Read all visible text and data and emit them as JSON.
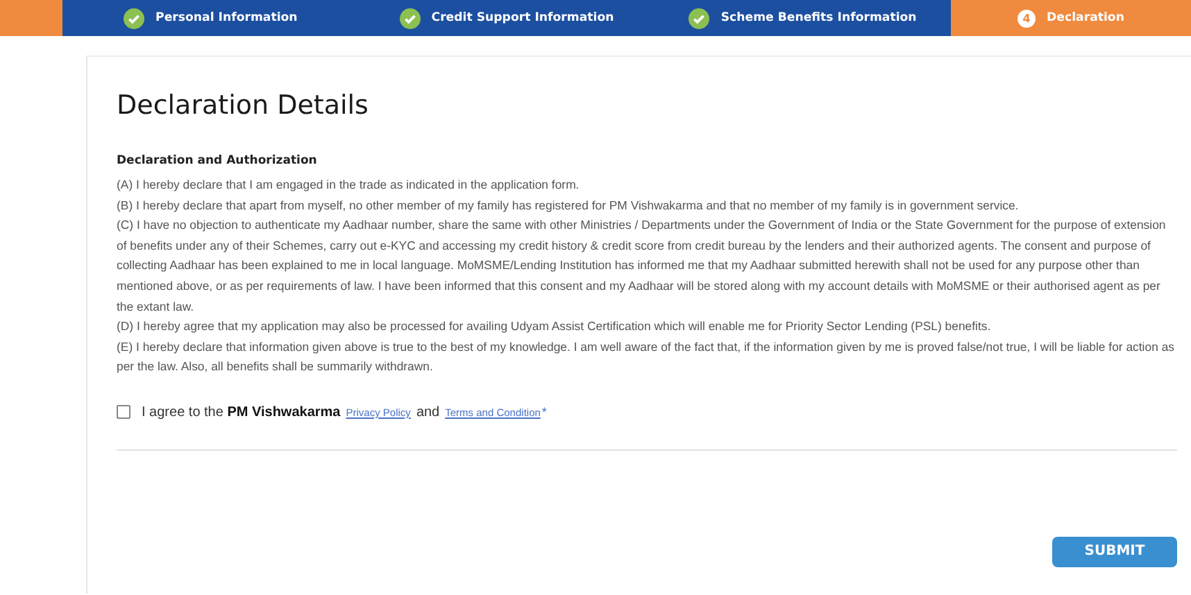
{
  "steps": [
    {
      "label": "Personal Information",
      "kind": "completed",
      "selected": false
    },
    {
      "label": "Credit Support Information",
      "kind": "completed",
      "selected": false
    },
    {
      "label": "Scheme Benefits Information",
      "kind": "completed",
      "selected": false
    },
    {
      "label": "Declaration",
      "kind": "current",
      "number": "4",
      "selected": true
    }
  ],
  "page_title": "Declaration Details",
  "section_title": "Declaration and Authorization",
  "declarations": [
    "(A) I hereby declare that I am engaged in the trade as indicated in the application form.",
    "(B) I hereby declare that apart from myself, no other member of my family has registered for PM Vishwakarma and that no member of my family is in government service.",
    "(C) I have no objection to authenticate my Aadhaar number, share the same with other Ministries / Departments under the Government of India or the State Government for the purpose of extension of benefits under any of their Schemes, carry out e-KYC and accessing my credit history & credit score from credit bureau by the lenders and their authorized agents. The consent and purpose of collecting Aadhaar has been explained to me in local language. MoMSME/Lending Institution has informed me that my Aadhaar submitted herewith shall not be used for any purpose other than mentioned above, or as per requirements of law. I have been informed that this consent and my Aadhaar will be stored along with my account details with MoMSME or their authorised agent as per the extant law.",
    "(D) I hereby agree that my application may also be processed for availing Udyam Assist Certification which will enable me for Priority Sector Lending (PSL) benefits.",
    "(E) I hereby declare that information given above is true to the best of my knowledge. I am well aware of the fact that, if the information given by me is proved false/not true, I will be liable for action as per the law. Also, all benefits shall be summarily withdrawn."
  ],
  "agreement": {
    "checked": false,
    "text": "I agree to the **PM Vishwakarma**",
    "privacy_link": "Privacy Policy",
    "joiner": "and",
    "terms_link": "Terms and Condition",
    "required_mark": "*"
  },
  "submit_button": "SUBMIT"
}
